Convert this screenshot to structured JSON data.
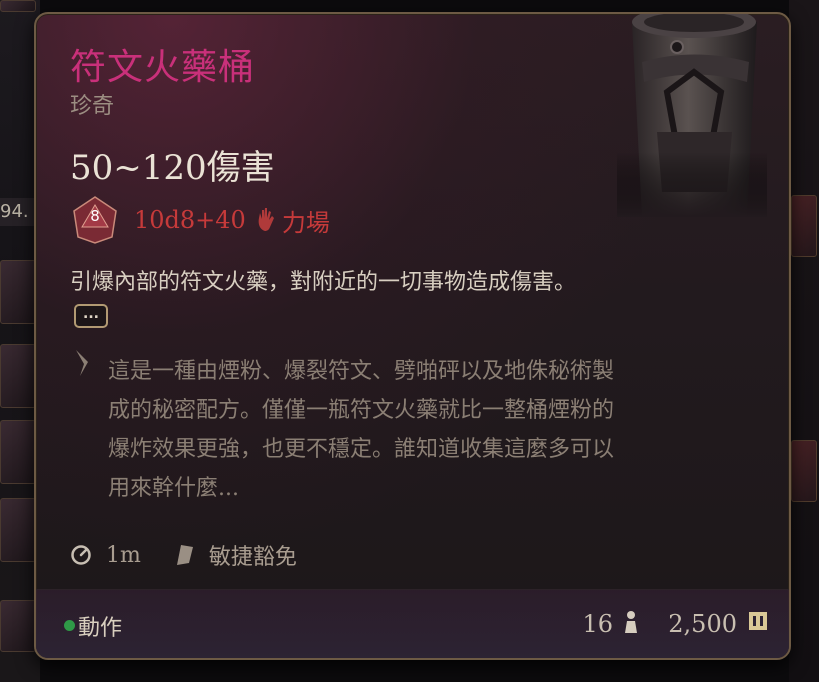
{
  "item": {
    "name": "符文火藥桶",
    "rarity": "珍奇",
    "damage_summary": "50~120傷害",
    "dice_label": "8",
    "damage_formula": "10d8+40",
    "damage_type": "力場",
    "description": "引爆內部的符文火藥，對附近的一切事物造成傷害。",
    "more_label": "...",
    "lore_lines": [
      "這是一種由煙粉、爆裂符文、劈啪砰以及地侏秘術製",
      "成的秘密配方。僅僅一瓶符文火藥就比一整桶煙粉的",
      "爆炸效果更強，也更不穩定。誰知道收集這麼多可以",
      "用來幹什麼..."
    ],
    "range": "1m",
    "save": "敏捷豁免"
  },
  "footer": {
    "action_type": "動作",
    "weight": "16",
    "price": "2,500"
  },
  "left_edge_number": "94.",
  "colors": {
    "title": "#c9307a",
    "damage": "#c63a3a",
    "action_dot": "#2f9a47",
    "border": "#6d5a44"
  },
  "icons": [
    "d8-dice-icon",
    "force-hand-icon",
    "lore-quill-icon",
    "range-clock-icon",
    "save-shield-icon",
    "weight-icon",
    "gold-coin-icon"
  ]
}
